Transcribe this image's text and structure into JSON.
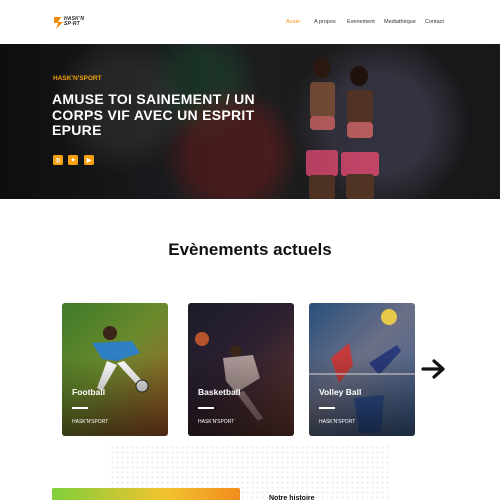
{
  "brand": {
    "logo_text_line1": "HASK'N",
    "logo_text_line2": "SP·RT"
  },
  "nav": {
    "items": [
      {
        "label": "Acuei",
        "active": true
      },
      {
        "label": "A propos",
        "active": false
      },
      {
        "label": "Evenement",
        "active": false
      },
      {
        "label": "Mediathèque",
        "active": false
      },
      {
        "label": "Contact",
        "active": false
      }
    ]
  },
  "hero": {
    "subtitle": "HASK'N'SPORT",
    "title": "AMUSE TOI SAINEMENT / UN CORPS VIF AVEC UN ESPRIT EPURE",
    "social": [
      {
        "icon": "instagram-icon",
        "glyph": "◎"
      },
      {
        "icon": "twitter-icon",
        "glyph": "✦"
      },
      {
        "icon": "youtube-icon",
        "glyph": "▶"
      }
    ]
  },
  "events": {
    "title": "Evènements actuels",
    "cards": [
      {
        "title": "Football",
        "tag": "HASK'N'SPORT"
      },
      {
        "title": "Basketball",
        "tag": "HASK'N'SPORT"
      },
      {
        "title": "Volley Ball",
        "tag": "HASK'N'SPORT"
      }
    ],
    "next_icon": "arrow-right-icon"
  },
  "history": {
    "title": "Notre histoire"
  },
  "colors": {
    "accent": "#f28c0f",
    "hero_subtitle": "#f5a00f"
  }
}
